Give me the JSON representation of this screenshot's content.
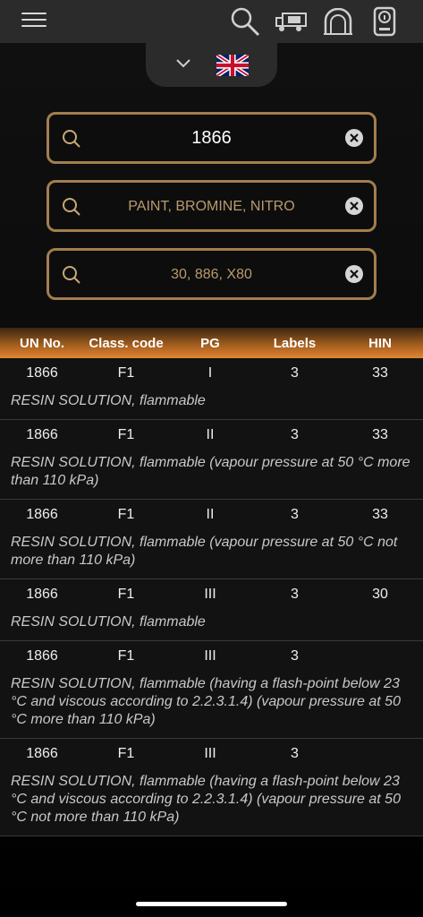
{
  "header": {
    "icons": [
      "menu-icon",
      "search-icon",
      "truck-icon",
      "tunnel-icon",
      "device-info-icon"
    ]
  },
  "language": {
    "flag": "united-kingdom-flag"
  },
  "search": {
    "un_value": "1866",
    "name_placeholder": "PAINT, BROMINE, NITRO",
    "hin_placeholder": "30, 886, X80"
  },
  "table": {
    "headers": {
      "un": "UN No.",
      "class": "Class. code",
      "pg": "PG",
      "labels": "Labels",
      "hin": "HIN"
    },
    "rows": [
      {
        "un": "1866",
        "class": "F1",
        "pg": "I",
        "labels": "3",
        "hin": "33",
        "desc": "RESIN SOLUTION, flammable"
      },
      {
        "un": "1866",
        "class": "F1",
        "pg": "II",
        "labels": "3",
        "hin": "33",
        "desc": "RESIN SOLUTION, flammable (vapour pressure at 50 °C more than 110 kPa)"
      },
      {
        "un": "1866",
        "class": "F1",
        "pg": "II",
        "labels": "3",
        "hin": "33",
        "desc": "RESIN SOLUTION, flammable (vapour pressure at 50 °C not more than 110 kPa)"
      },
      {
        "un": "1866",
        "class": "F1",
        "pg": "III",
        "labels": "3",
        "hin": "30",
        "desc": "RESIN SOLUTION, flammable"
      },
      {
        "un": "1866",
        "class": "F1",
        "pg": "III",
        "labels": "3",
        "hin": "",
        "desc": "RESIN SOLUTION, flammable (having a flash-point below 23 °C and viscous according to 2.2.3.1.4) (vapour pressure at 50 °C more than 110 kPa)"
      },
      {
        "un": "1866",
        "class": "F1",
        "pg": "III",
        "labels": "3",
        "hin": "",
        "desc": "RESIN SOLUTION, flammable (having a flash-point below 23 °C and viscous according to 2.2.3.1.4) (vapour pressure at 50 °C not more than 110 kPa)"
      }
    ]
  },
  "colors": {
    "accent": "#a27e4e",
    "header_orange": "#e28535",
    "background": "#000000"
  }
}
